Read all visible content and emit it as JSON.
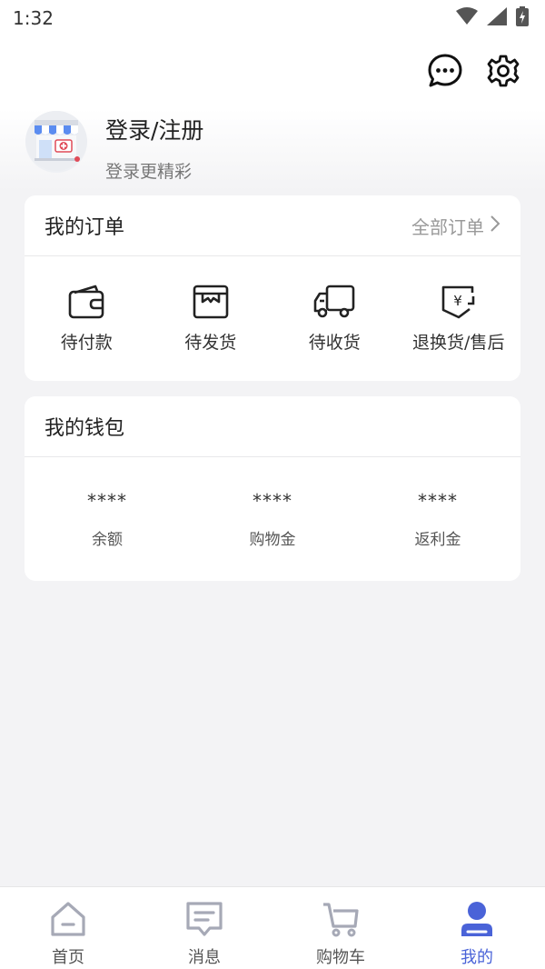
{
  "status_bar": {
    "time": "1:32"
  },
  "profile": {
    "title": "登录/注册",
    "subtitle": "登录更精彩",
    "avatar_icon": "store-avatar-icon"
  },
  "header": {
    "message_icon": "chat-bubble-icon",
    "settings_icon": "gear-icon"
  },
  "orders": {
    "title": "我的订单",
    "all_link": "全部订单",
    "items": [
      {
        "label": "待付款",
        "icon": "wallet-icon"
      },
      {
        "label": "待发货",
        "icon": "box-icon"
      },
      {
        "label": "待收货",
        "icon": "truck-icon"
      },
      {
        "label": "退换货/售后",
        "icon": "refund-icon"
      }
    ]
  },
  "wallet": {
    "title": "我的钱包",
    "items": [
      {
        "value": "****",
        "label": "余额"
      },
      {
        "value": "****",
        "label": "购物金"
      },
      {
        "value": "****",
        "label": "返利金"
      }
    ]
  },
  "tabbar": {
    "items": [
      {
        "label": "首页",
        "icon": "home-icon"
      },
      {
        "label": "消息",
        "icon": "message-icon"
      },
      {
        "label": "购物车",
        "icon": "cart-icon"
      },
      {
        "label": "我的",
        "icon": "user-icon"
      }
    ],
    "active_color": "#4a63d8",
    "inactive_color": "#a6a9b6"
  }
}
